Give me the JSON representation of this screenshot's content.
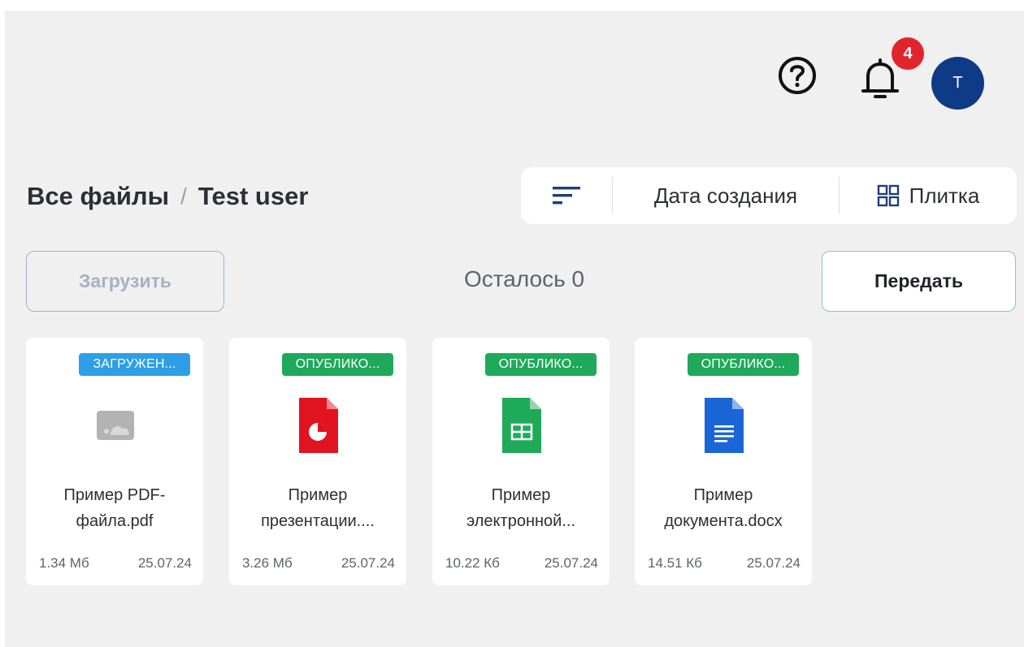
{
  "header": {
    "help_icon": "help-circle-icon",
    "bell_icon": "bell-icon",
    "notification_count": "4",
    "avatar_initial": "T",
    "avatar_color": "#0f3a86",
    "badge_color": "#e1242d"
  },
  "breadcrumb": {
    "root": "Все файлы",
    "separator": "/",
    "current": "Test user"
  },
  "toolbar": {
    "sort_icon": "sort-lines-icon",
    "sort_field": "Дата создания",
    "view_icon": "grid-icon",
    "view_label": "Плитка"
  },
  "actions": {
    "upload_label": "Загрузить",
    "remaining_label": "Осталось 0",
    "transfer_label": "Передать"
  },
  "files": [
    {
      "status": "ЗАГРУЖЕН...",
      "status_color": "#2e9fe6",
      "icon": "image-placeholder-icon",
      "name_line1": "Пример PDF-",
      "name_line2": "файла.pdf",
      "size": "1.34 Мб",
      "date": "25.07.24"
    },
    {
      "status": "ОПУБЛИКО...",
      "status_color": "#1fa95b",
      "icon": "presentation-file-icon",
      "name_line1": "Пример",
      "name_line2": "презентации....",
      "size": "3.26 Мб",
      "date": "25.07.24"
    },
    {
      "status": "ОПУБЛИКО...",
      "status_color": "#1fa95b",
      "icon": "spreadsheet-file-icon",
      "name_line1": "Пример",
      "name_line2": "электронной...",
      "size": "10.22 Кб",
      "date": "25.07.24"
    },
    {
      "status": "ОПУБЛИКО...",
      "status_color": "#1fa95b",
      "icon": "document-file-icon",
      "name_line1": "Пример",
      "name_line2": "документа.docx",
      "size": "14.51 Кб",
      "date": "25.07.24"
    }
  ]
}
